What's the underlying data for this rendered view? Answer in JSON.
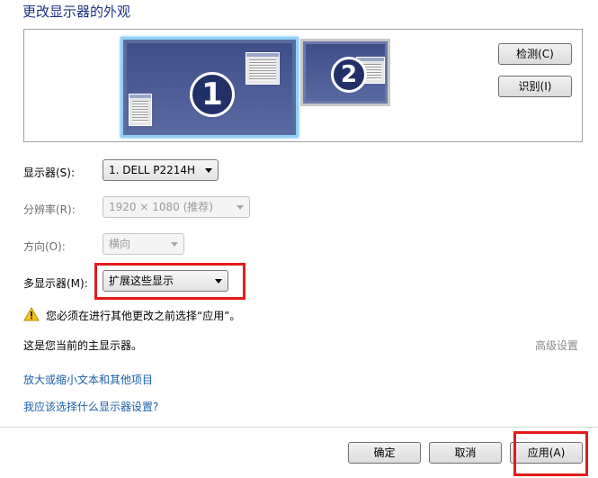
{
  "title": "更改显示器的外观",
  "preview": {
    "monitor1_number": "1",
    "monitor2_number": "2",
    "detect_button": "检测(C)",
    "identify_button": "识别(I)"
  },
  "settings": {
    "display_label": "显示器(S):",
    "display_value": "1. DELL P2214H",
    "resolution_label": "分辨率(R):",
    "resolution_value": "1920 × 1080 (推荐)",
    "orientation_label": "方向(O):",
    "orientation_value": "横向",
    "multiple_label": "多显示器(M):",
    "multiple_value": "扩展这些显示"
  },
  "warning_text": "您必须在进行其他更改之前选择“应用”。",
  "primary_text": "这是您当前的主显示器。",
  "advanced_link": "高级设置",
  "links": {
    "enlarge": "放大或缩小文本和其他项目",
    "which_settings": "我应该选择什么显示器设置?"
  },
  "footer": {
    "ok": "确定",
    "cancel": "取消",
    "apply": "应用(A)"
  },
  "colors": {
    "title": "#1e3287",
    "link": "#1c5fa8",
    "highlight": "#e31b1b"
  }
}
